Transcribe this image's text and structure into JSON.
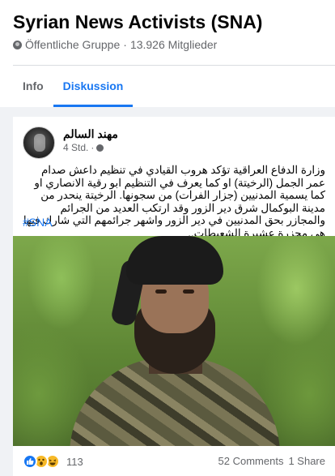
{
  "group": {
    "title": "Syrian News Activists (SNA)",
    "privacy": "Öffentliche Gruppe",
    "separator": "·",
    "members": "13.926 Mitglieder"
  },
  "tabs": [
    {
      "label": "Info",
      "active": false
    },
    {
      "label": "Diskussion",
      "active": true
    }
  ],
  "post": {
    "author": "مهند السالم",
    "time": "4 Std.",
    "separator": "·",
    "text": "وزارة الدفاع العراقية تؤكد هروب القيادي في تنظيم داعش صدام عمر الجمل (الرخيتة) او كما يعرف في التنظيم ابو رقية الانصاري او كما يسمية المدنيين (جزار الفرات) من سجونها. الرخيتة ينحدر من مدينة البوكمال شرق دير الزور وقد ارتكب العديد من الجرائم والمجازر بحق المدنيين في دير الزور واشهر جرائمهم التي شارك فيها هي مجزرة عشيرة الشعيطات..",
    "hashtag": "#SNA",
    "reaction_count": "113",
    "comments": "52 Comments",
    "shares": "1 Share"
  },
  "colors": {
    "accent": "#1877f2",
    "muted": "#65676b",
    "text": "#050505",
    "background": "#f0f2f5"
  },
  "icons": [
    "globe-icon",
    "like-reaction-icon",
    "wow-reaction-icon",
    "haha-reaction-icon"
  ]
}
